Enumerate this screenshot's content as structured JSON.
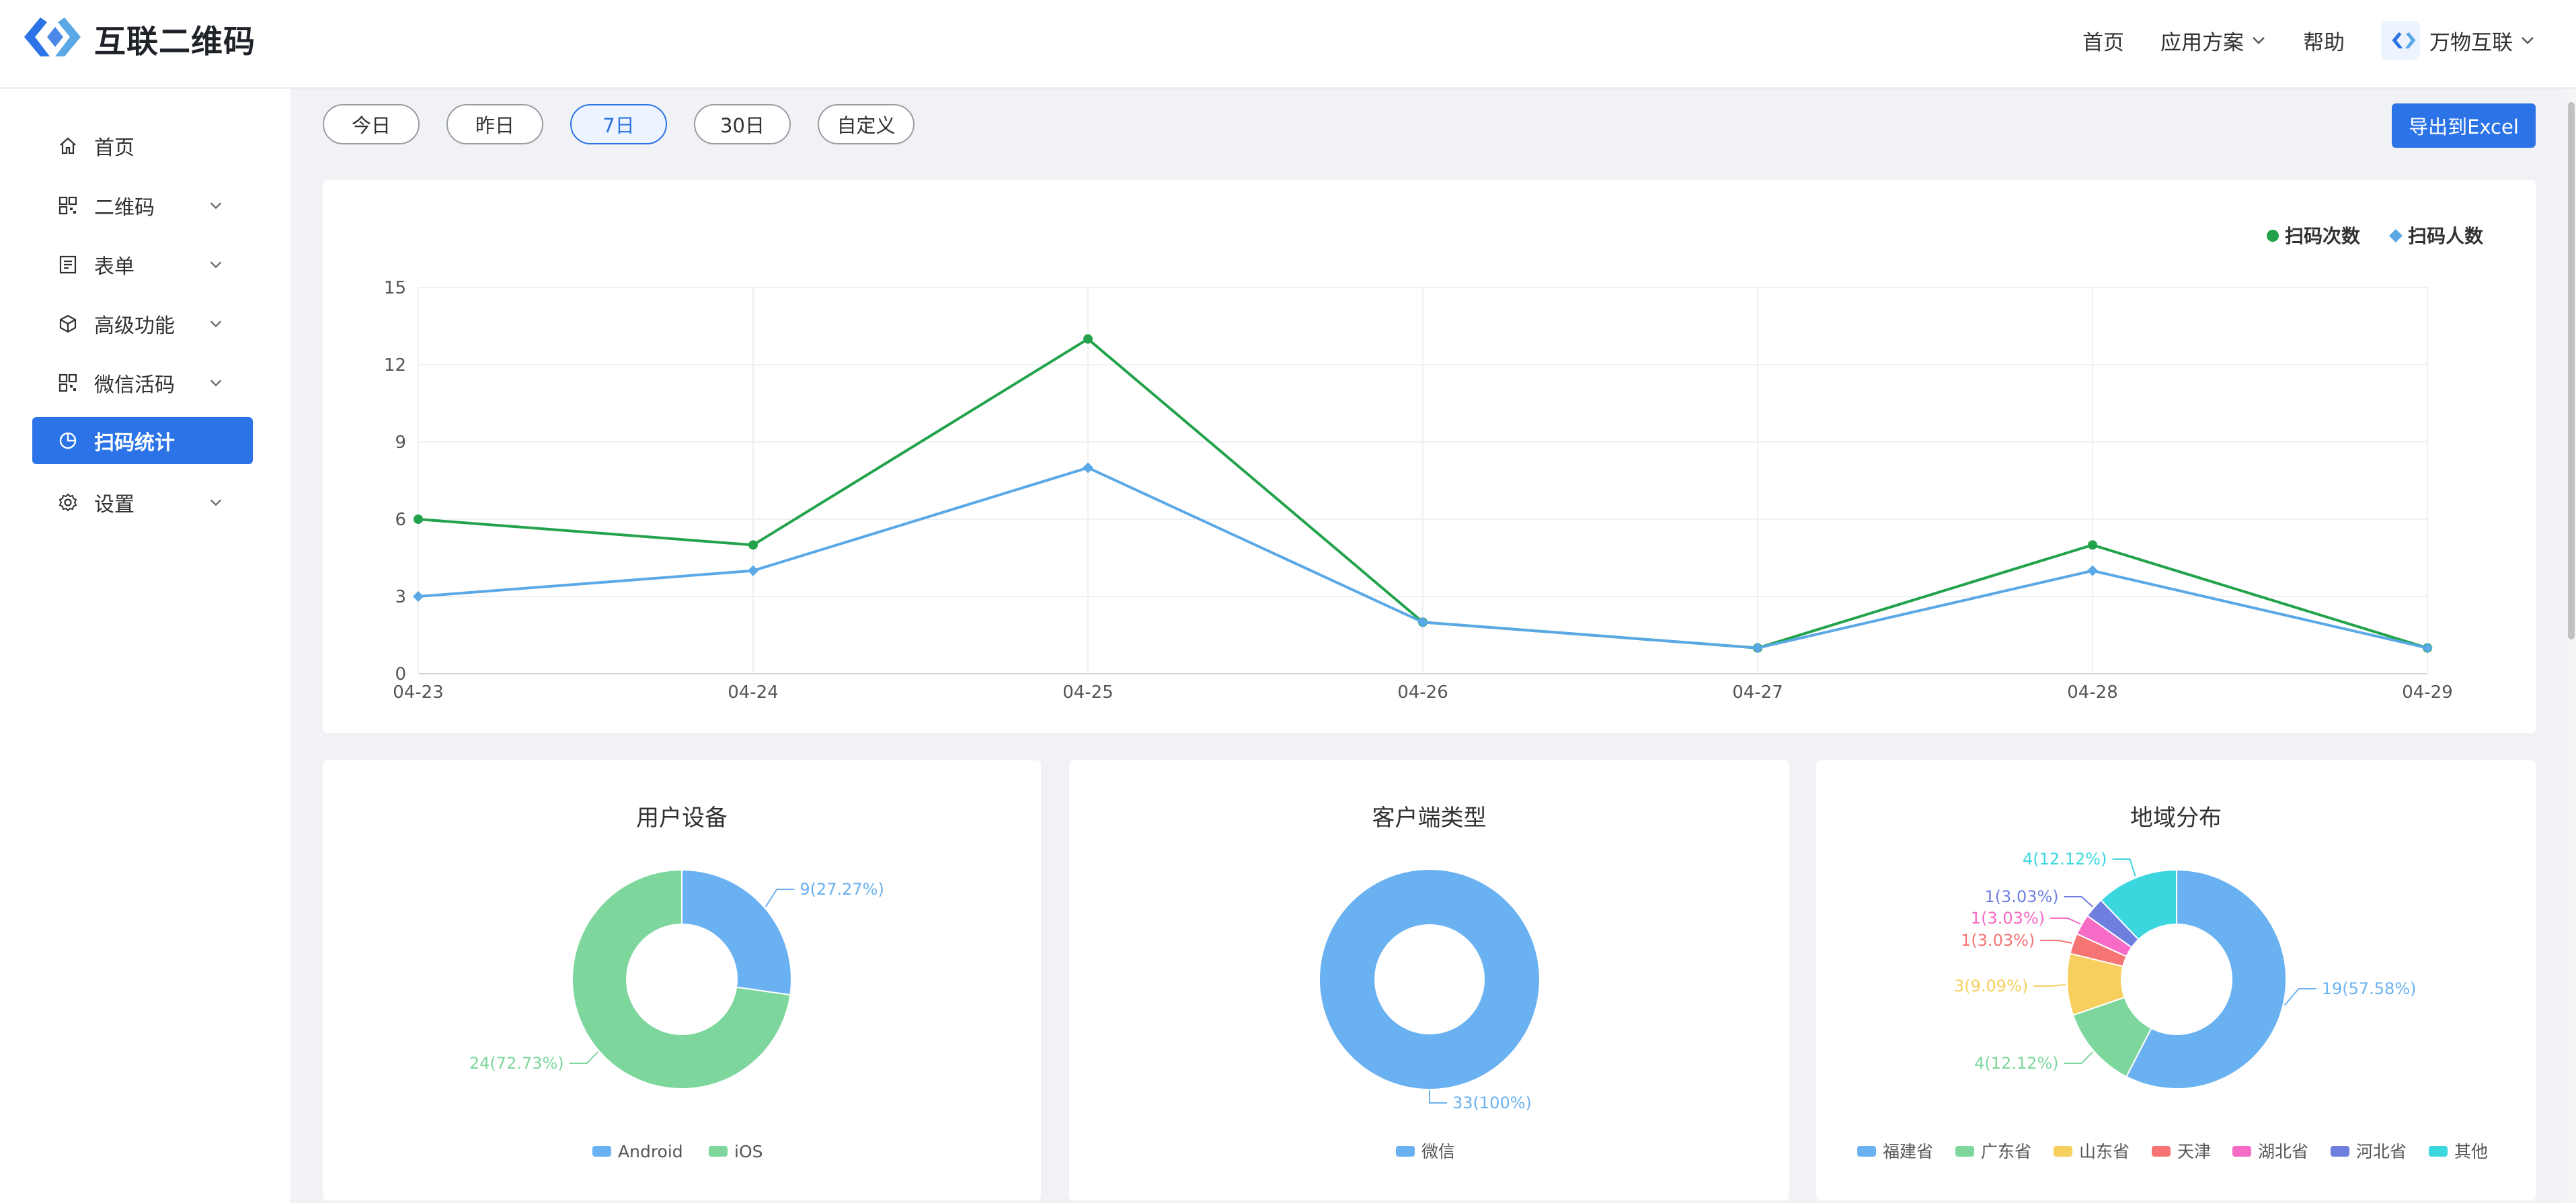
{
  "header": {
    "app_name": "互联二维码",
    "nav": [
      {
        "label": "首页"
      },
      {
        "label": "应用方案"
      },
      {
        "label": "帮助"
      },
      {
        "label": "万物互联"
      }
    ]
  },
  "sidebar": {
    "items": [
      {
        "label": "首页",
        "icon": "home-icon"
      },
      {
        "label": "二维码",
        "icon": "qrcode-icon"
      },
      {
        "label": "表单",
        "icon": "form-icon"
      },
      {
        "label": "高级功能",
        "icon": "cube-icon"
      },
      {
        "label": "微信活码",
        "icon": "qrcode-icon"
      },
      {
        "label": "扫码统计",
        "icon": "pie-chart-icon",
        "active": true
      },
      {
        "label": "设置",
        "icon": "gear-icon"
      }
    ]
  },
  "toolbar": {
    "ranges": [
      "今日",
      "昨日",
      "7日",
      "30日",
      "自定义"
    ],
    "selected": "7日",
    "export_label": "导出到Excel"
  },
  "colors": {
    "accent": "#2b73e6",
    "line_scans": "#22a34b",
    "line_users": "#5aa8e6"
  },
  "chart_data": [
    {
      "type": "line",
      "x": [
        "04-23",
        "04-24",
        "04-25",
        "04-26",
        "04-27",
        "04-28",
        "04-29"
      ],
      "ylim": [
        0,
        15
      ],
      "yticks": [
        0,
        3,
        6,
        9,
        12,
        15
      ],
      "legend": "top-right",
      "grid": true,
      "series": [
        {
          "name": "扫码次数",
          "values": [
            6,
            5,
            13,
            2,
            1,
            5,
            1
          ],
          "color": "#22a34b",
          "marker": "circle"
        },
        {
          "name": "扫码人数",
          "values": [
            3,
            4,
            8,
            2,
            1,
            4,
            1
          ],
          "color": "#5aa8e6",
          "marker": "diamond"
        }
      ]
    },
    {
      "type": "pie",
      "title": "用户设备",
      "slices": [
        {
          "name": "Android",
          "value": 9,
          "label": "9(27.27%)",
          "color": "#6ab1f1"
        },
        {
          "name": "iOS",
          "value": 24,
          "label": "24(72.73%)",
          "color": "#7dd69c"
        }
      ]
    },
    {
      "type": "pie",
      "title": "客户端类型",
      "slices": [
        {
          "name": "微信",
          "value": 33,
          "label": "33(100%)",
          "color": "#6ab1f1"
        }
      ]
    },
    {
      "type": "pie",
      "title": "地域分布",
      "slices": [
        {
          "name": "福建省",
          "value": 19,
          "label": "19(57.58%)",
          "color": "#6ab1f1"
        },
        {
          "name": "广东省",
          "value": 4,
          "label": "4(12.12%)",
          "color": "#7dd69c"
        },
        {
          "name": "山东省",
          "value": 3,
          "label": "3(9.09%)",
          "color": "#f6cf5e"
        },
        {
          "name": "天津",
          "value": 1,
          "label": "1(3.03%)",
          "color": "#f67474"
        },
        {
          "name": "湖北省",
          "value": 1,
          "label": "1(3.03%)",
          "color": "#f56bc6"
        },
        {
          "name": "河北省",
          "value": 1,
          "label": "1(3.03%)",
          "color": "#6f7fe0"
        },
        {
          "name": "其他",
          "value": 4,
          "label": "4(12.12%)",
          "color": "#3cd6df"
        }
      ]
    }
  ]
}
